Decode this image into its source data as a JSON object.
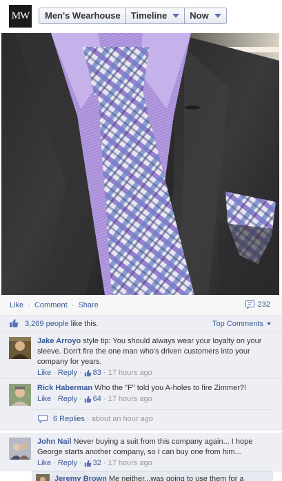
{
  "header": {
    "logo_text": "MW",
    "breadcrumb": [
      {
        "label": "Men's Wearhouse",
        "has_caret": false
      },
      {
        "label": "Timeline",
        "has_caret": true
      },
      {
        "label": "Now",
        "has_caret": true
      }
    ]
  },
  "post": {
    "actions": {
      "like": "Like",
      "comment": "Comment",
      "share": "Share",
      "sep": "·"
    },
    "share_count": "232",
    "likes_count": "3,269 people",
    "likes_suffix": " like this.",
    "top_comments": "Top Comments"
  },
  "comments": [
    {
      "name": "Jake Arroyo",
      "text": "style tip: You should always wear your loyalty on your sleeve. Don't fire the one man who's driven customers into your company for years.",
      "like": "Like",
      "reply": "Reply",
      "likes": "83",
      "time": "17 hours ago"
    },
    {
      "name": "Rick Haberman",
      "text": "Who the \"F\" told you A-holes to fire Zimmer?!",
      "like": "Like",
      "reply": "Reply",
      "likes": "64",
      "time": "17 hours ago"
    },
    {
      "name": "John Nail",
      "text": "Never buying a suit from this company again... I hope George starts another company, so I can buy one from him...",
      "like": "Like",
      "reply": "Reply",
      "likes": "32",
      "time": "17 hours ago"
    }
  ],
  "replies_summary": {
    "count_label": "6 Replies",
    "time": "about an hour ago"
  },
  "reply_preview": {
    "name": "Jeremy Brown",
    "text": "Me neither...was going to use them for a"
  },
  "colors": {
    "link": "#3b5998",
    "comment_bg": "#edeff4",
    "tie_purple": "#8a6fc9",
    "shirt_lavender": "#b9a3e3"
  },
  "icons": {
    "share": "share-count-icon",
    "like": "thumbs-up-icon",
    "replies": "speech-bubble-icon"
  }
}
